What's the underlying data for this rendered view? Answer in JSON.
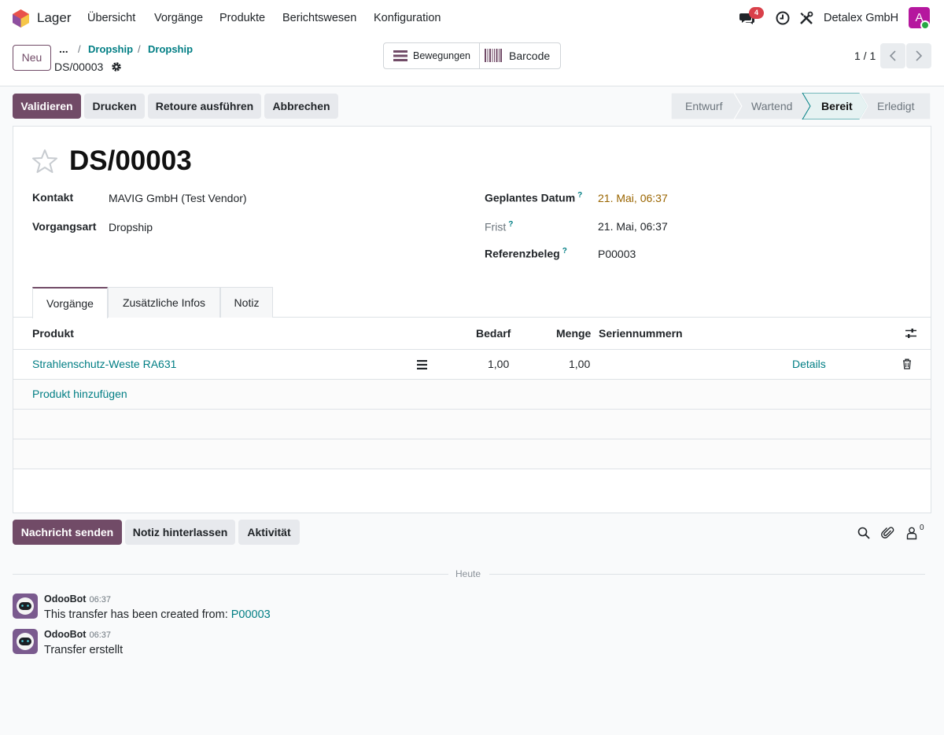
{
  "app": {
    "name": "Lager"
  },
  "menu": [
    "Übersicht",
    "Vorgänge",
    "Produkte",
    "Berichtswesen",
    "Konfiguration"
  ],
  "systray": {
    "message_count": "4",
    "company": "Detalex GmbH",
    "avatar_letter": "A"
  },
  "control": {
    "new_label": "Neu",
    "breadcrumb_more": "...",
    "breadcrumbs": [
      "Dropship",
      "Dropship"
    ],
    "record_name": "DS/00003",
    "smart_buttons": [
      "Bewegungen",
      "Barcode"
    ],
    "pager": "1 / 1"
  },
  "actions": [
    "Validieren",
    "Drucken",
    "Retoure ausführen",
    "Abbrechen"
  ],
  "statusbar": {
    "steps": [
      "Entwurf",
      "Wartend",
      "Bereit",
      "Erledigt"
    ],
    "current": "Bereit"
  },
  "form": {
    "title": "DS/00003",
    "left": [
      {
        "label": "Kontakt",
        "value": "MAVIG GmbH (Test Vendor)"
      },
      {
        "label": "Vorgangsart",
        "value": "Dropship"
      }
    ],
    "right": [
      {
        "label": "Geplantes Datum",
        "help": "?",
        "value": "21. Mai, 06:37"
      },
      {
        "label": "Frist",
        "help": "?",
        "value": "21. Mai, 06:37"
      },
      {
        "label": "Referenzbeleg",
        "help": "?",
        "value": "P00003"
      }
    ],
    "tabs": [
      "Vorgänge",
      "Zusätzliche Infos",
      "Notiz"
    ],
    "table": {
      "columns": [
        "Produkt",
        "Bedarf",
        "Menge",
        "Seriennummern"
      ],
      "rows": [
        {
          "product": "Strahlenschutz-Weste RA631",
          "demand": "1,00",
          "quantity": "1,00",
          "serial": "",
          "details": "Details"
        }
      ],
      "add_line": "Produkt hinzufügen"
    }
  },
  "chatter": {
    "buttons": [
      "Nachricht senden",
      "Notiz hinterlassen",
      "Aktivität"
    ],
    "follower_count": "0",
    "separator": "Heute",
    "messages": [
      {
        "author": "OdooBot",
        "time": "06:37",
        "body": "This transfer has been created from: ",
        "link": "P00003"
      },
      {
        "author": "OdooBot",
        "time": "06:37",
        "body": "Transfer erstellt"
      }
    ]
  },
  "colors": {
    "brand": "#714b67",
    "link": "#017e84",
    "warning": "#9a6500",
    "badge": "#d9404a"
  }
}
